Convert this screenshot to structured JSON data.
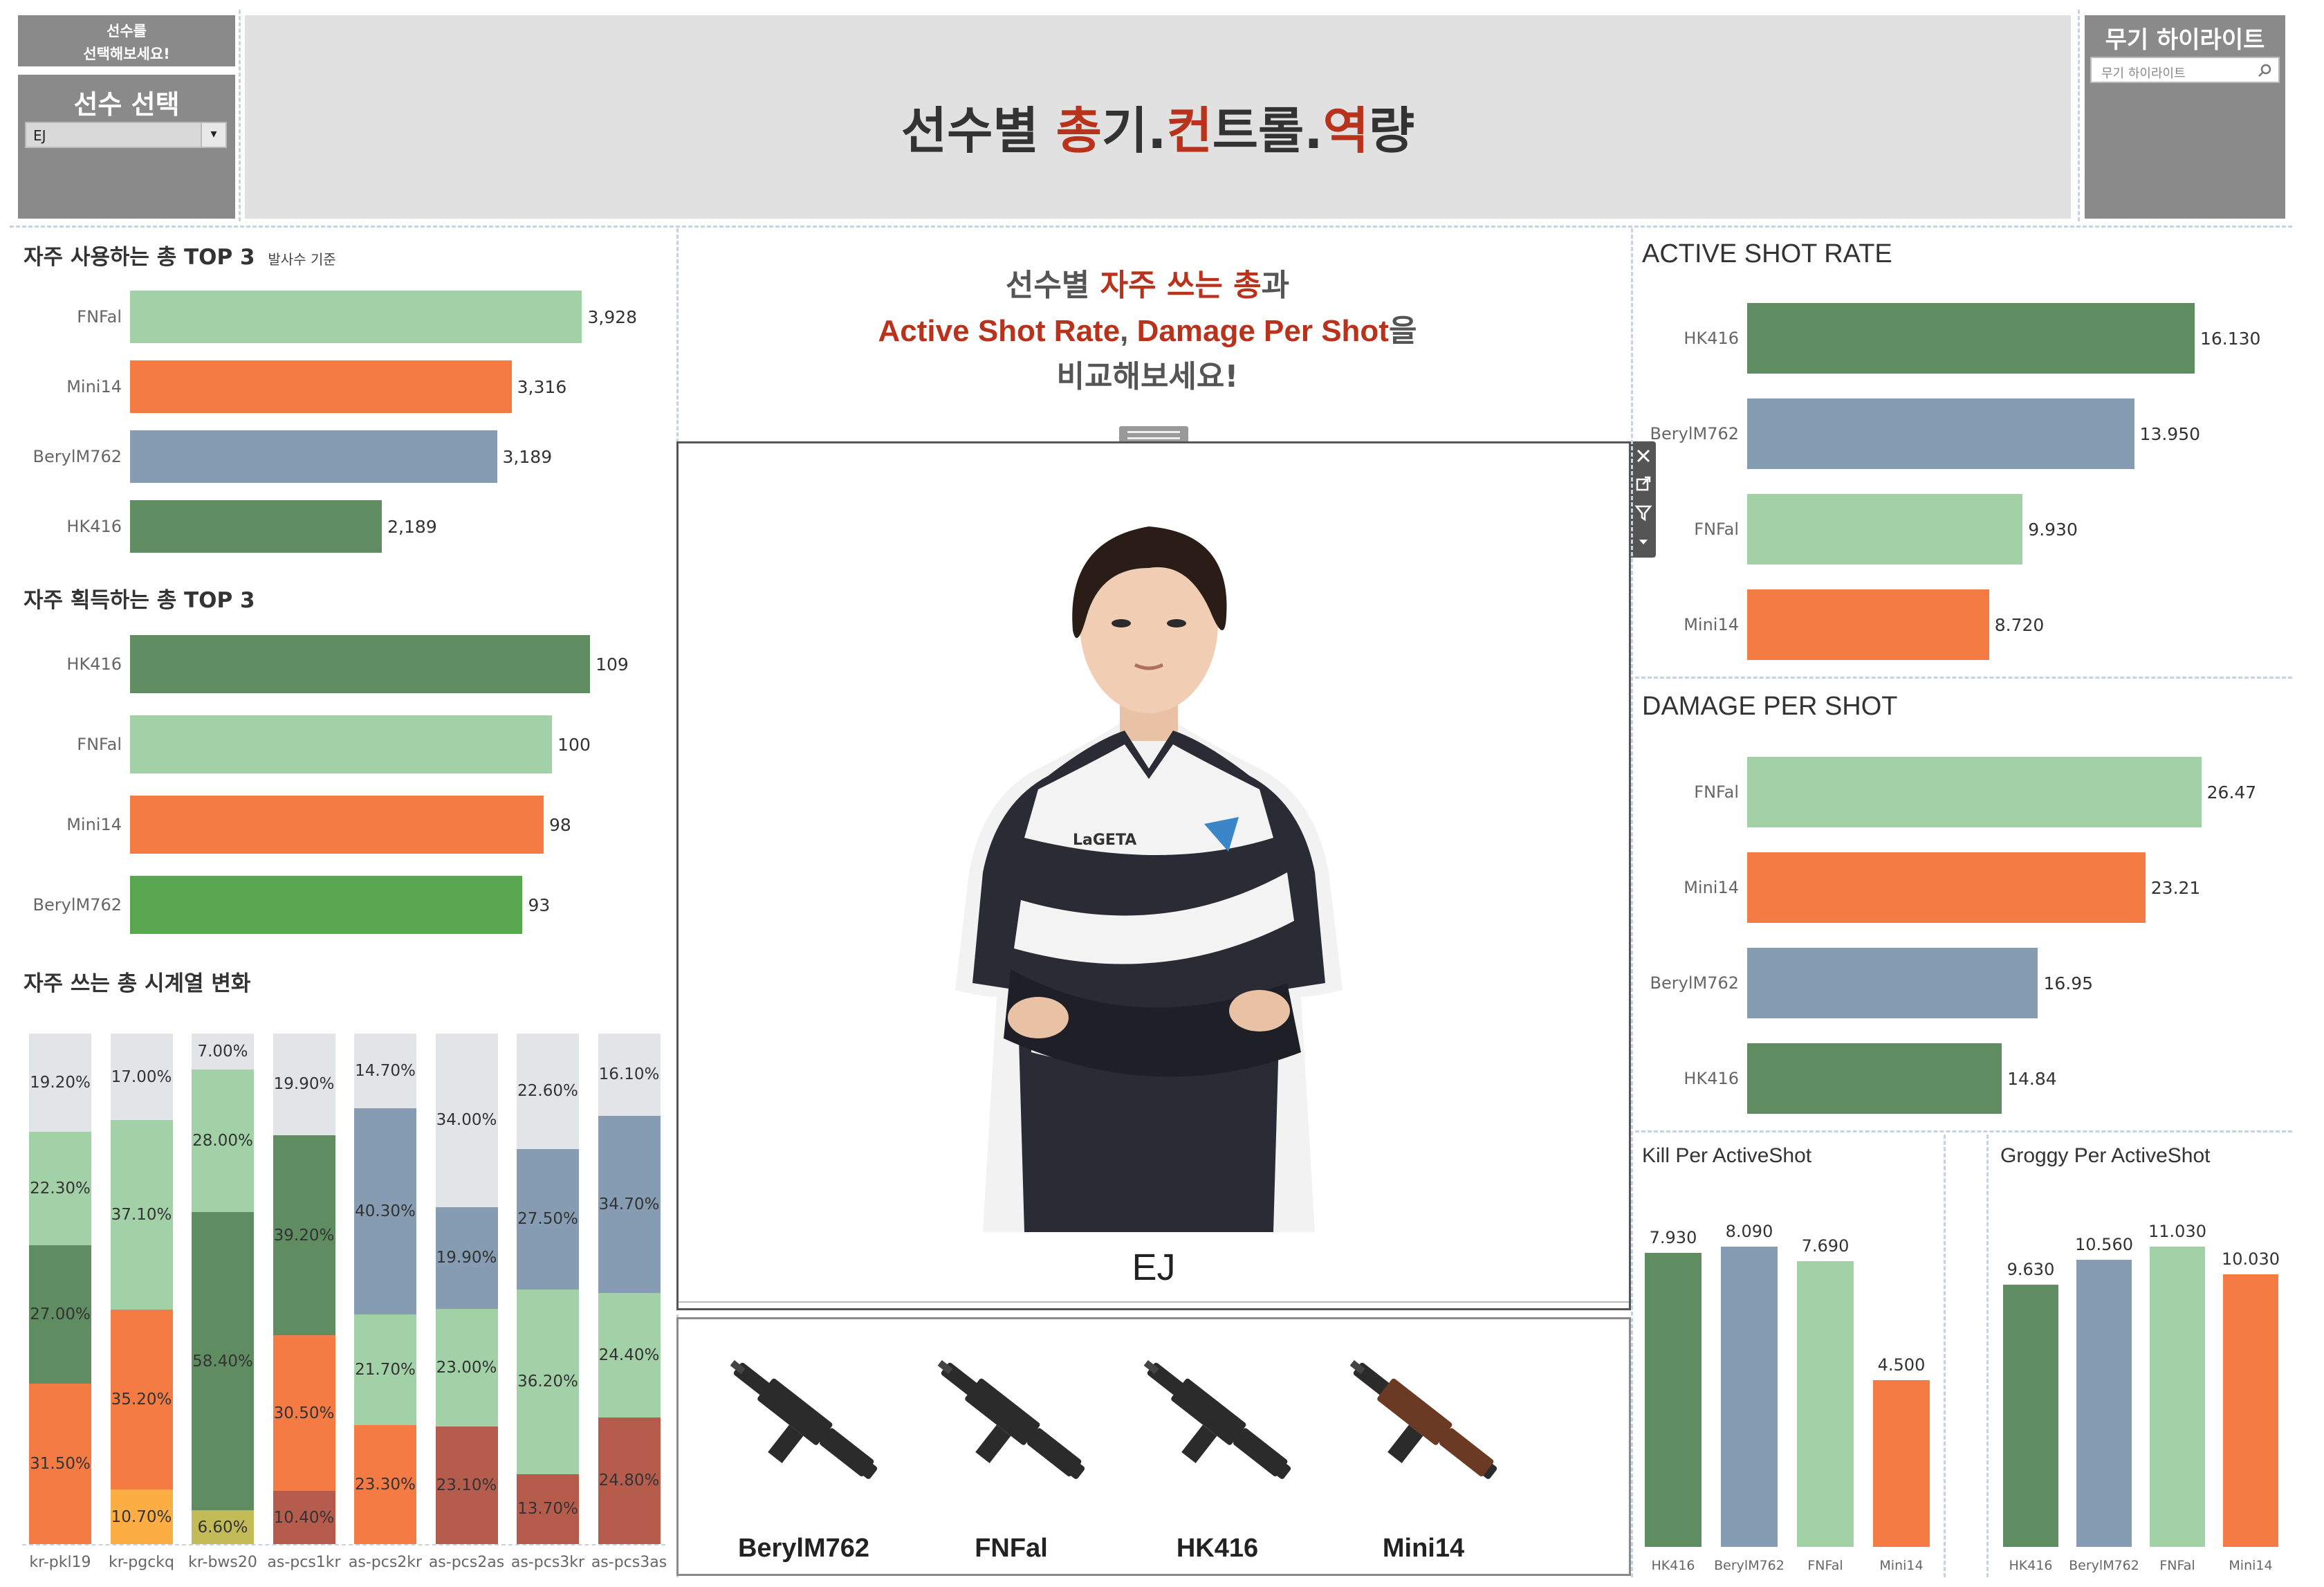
{
  "top_left": {
    "prompt_line1": "선수를",
    "prompt_line2": "선택해보세요!",
    "select_title": "선수 선택",
    "select_value": "EJ"
  },
  "header": {
    "title_parts": [
      {
        "text": "선수별 ",
        "accent": false
      },
      {
        "text": "총",
        "accent": true
      },
      {
        "text": "기.",
        "accent": false
      },
      {
        "text": "컨",
        "accent": true
      },
      {
        "text": "트롤.",
        "accent": false
      },
      {
        "text": "역",
        "accent": true
      },
      {
        "text": "량",
        "accent": false
      }
    ]
  },
  "top_right": {
    "title": "무기 하이라이트",
    "search_placeholder": "무기 하이라이트",
    "search_icon": "search-icon"
  },
  "colors": {
    "light_green": "#a3d1a7",
    "orange": "#f47b43",
    "blue_gray": "#859cb3",
    "dark_green": "#5f8c60",
    "bright_green": "#58a650",
    "light_gray": "#e2e4e7",
    "yellow_orange": "#fcae45",
    "brick": "#b65c4d",
    "olive": "#c3bb58",
    "accent_red": "#b8321c"
  },
  "center": {
    "intro_line1_a": "선수별 ",
    "intro_line1_b": "자주 쓰는 총",
    "intro_line1_c": "과",
    "intro_line2_a": "Active Shot Rate",
    "intro_line2_b": ", ",
    "intro_line2_c": "Damage Per Shot",
    "intro_line2_d": "을",
    "intro_line3": "비교해보세요!",
    "player_name": "EJ",
    "player_jersey_sponsor": "LaGETA",
    "viz_tools": [
      "close-icon",
      "external-link-icon",
      "filter-icon",
      "dropdown-icon"
    ]
  },
  "weapons": [
    {
      "name": "BerylM762"
    },
    {
      "name": "FNFal"
    },
    {
      "name": "HK416"
    },
    {
      "name": "Mini14"
    }
  ],
  "chart_data": [
    {
      "id": "top_used",
      "type": "bar",
      "title": "자주 사용하는 총 TOP 3",
      "subtitle": "발사수 기준",
      "categories": [
        "FNFal",
        "Mini14",
        "BerylM762",
        "HK416"
      ],
      "values": [
        3928,
        3316,
        3189,
        2189
      ],
      "value_labels": [
        "3,928",
        "3,316",
        "3,189",
        "2,189"
      ],
      "colors": [
        "#a3d1a7",
        "#f47b43",
        "#859cb3",
        "#5f8c60"
      ],
      "xlim": [
        0,
        4400
      ]
    },
    {
      "id": "top_acquired",
      "type": "bar",
      "title": "자주 획득하는 총 TOP 3",
      "categories": [
        "HK416",
        "FNFal",
        "Mini14",
        "BerylM762"
      ],
      "values": [
        109,
        100,
        98,
        93
      ],
      "value_labels": [
        "109",
        "100",
        "98",
        "93"
      ],
      "colors": [
        "#5f8c60",
        "#a3d1a7",
        "#f47b43",
        "#58a650"
      ],
      "xlim": [
        0,
        118
      ]
    },
    {
      "id": "timeseries",
      "type": "bar",
      "title": "자주 쓰는 총 시계열 변화",
      "categories": [
        "kr-pkl19",
        "kr-pgckq",
        "kr-bws20",
        "as-pcs1kr",
        "as-pcs2kr",
        "as-pcs2as",
        "as-pcs3kr",
        "as-pcs3as"
      ],
      "stacks": [
        [
          {
            "v": 19.2,
            "l": "19.20%",
            "c": "#e2e4e7"
          },
          {
            "v": 22.3,
            "l": "22.30%",
            "c": "#a3d1a7"
          },
          {
            "v": 27.0,
            "l": "27.00%",
            "c": "#5f8c60"
          },
          {
            "v": 31.5,
            "l": "31.50%",
            "c": "#f47b43"
          }
        ],
        [
          {
            "v": 17.0,
            "l": "17.00%",
            "c": "#e2e4e7"
          },
          {
            "v": 37.1,
            "l": "37.10%",
            "c": "#a3d1a7"
          },
          {
            "v": 35.2,
            "l": "35.20%",
            "c": "#f47b43"
          },
          {
            "v": 10.7,
            "l": "10.70%",
            "c": "#fcae45"
          }
        ],
        [
          {
            "v": 7.0,
            "l": "7.00%",
            "c": "#e2e4e7"
          },
          {
            "v": 28.0,
            "l": "28.00%",
            "c": "#a3d1a7"
          },
          {
            "v": 58.4,
            "l": "58.40%",
            "c": "#5f8c60"
          },
          {
            "v": 6.6,
            "l": "6.60%",
            "c": "#c3bb58"
          }
        ],
        [
          {
            "v": 19.9,
            "l": "19.90%",
            "c": "#e2e4e7"
          },
          {
            "v": 39.2,
            "l": "39.20%",
            "c": "#5f8c60"
          },
          {
            "v": 30.5,
            "l": "30.50%",
            "c": "#f47b43"
          },
          {
            "v": 10.4,
            "l": "10.40%",
            "c": "#b65c4d"
          }
        ],
        [
          {
            "v": 14.7,
            "l": "14.70%",
            "c": "#e2e4e7"
          },
          {
            "v": 40.3,
            "l": "40.30%",
            "c": "#859cb3"
          },
          {
            "v": 21.7,
            "l": "21.70%",
            "c": "#a3d1a7"
          },
          {
            "v": 23.3,
            "l": "23.30%",
            "c": "#f47b43"
          }
        ],
        [
          {
            "v": 34.0,
            "l": "34.00%",
            "c": "#e2e4e7"
          },
          {
            "v": 19.9,
            "l": "19.90%",
            "c": "#859cb3"
          },
          {
            "v": 23.0,
            "l": "23.00%",
            "c": "#a3d1a7"
          },
          {
            "v": 23.1,
            "l": "23.10%",
            "c": "#b65c4d"
          }
        ],
        [
          {
            "v": 22.6,
            "l": "22.60%",
            "c": "#e2e4e7"
          },
          {
            "v": 27.5,
            "l": "27.50%",
            "c": "#859cb3"
          },
          {
            "v": 36.2,
            "l": "36.20%",
            "c": "#a3d1a7"
          },
          {
            "v": 13.7,
            "l": "13.70%",
            "c": "#b65c4d"
          }
        ],
        [
          {
            "v": 16.1,
            "l": "16.10%",
            "c": "#e2e4e7"
          },
          {
            "v": 34.7,
            "l": "34.70%",
            "c": "#859cb3"
          },
          {
            "v": 24.4,
            "l": "24.40%",
            "c": "#a3d1a7"
          },
          {
            "v": 24.8,
            "l": "24.80%",
            "c": "#b65c4d"
          }
        ]
      ]
    },
    {
      "id": "active_shot_rate",
      "type": "bar",
      "title": "ACTIVE SHOT RATE",
      "categories": [
        "HK416",
        "BerylM762",
        "FNFal",
        "Mini14"
      ],
      "values": [
        16.13,
        13.95,
        9.93,
        8.72
      ],
      "value_labels": [
        "16.130",
        "13.950",
        "9.930",
        "8.720"
      ],
      "colors": [
        "#5f8c60",
        "#859cb3",
        "#a3d1a7",
        "#f47b43"
      ],
      "xlim": [
        0,
        18
      ]
    },
    {
      "id": "damage_per_shot",
      "type": "bar",
      "title": "DAMAGE PER SHOT",
      "categories": [
        "FNFal",
        "Mini14",
        "BerylM762",
        "HK416"
      ],
      "values": [
        26.47,
        23.21,
        16.95,
        14.84
      ],
      "value_labels": [
        "26.47",
        "23.21",
        "16.95",
        "14.84"
      ],
      "colors": [
        "#a3d1a7",
        "#f47b43",
        "#859cb3",
        "#5f8c60"
      ],
      "xlim": [
        0,
        28.5
      ]
    },
    {
      "id": "kill_per_activeshot",
      "type": "bar",
      "title": "Kill Per ActiveShot",
      "categories": [
        "HK416",
        "BerylM762",
        "FNFal",
        "Mini14"
      ],
      "values": [
        7.93,
        8.09,
        7.69,
        4.5
      ],
      "value_labels": [
        "7.930",
        "8.090",
        "7.690",
        "4.500"
      ],
      "colors": [
        "#5f8c60",
        "#859cb3",
        "#a3d1a7",
        "#f47b43"
      ],
      "ylim": [
        0,
        8.5
      ]
    },
    {
      "id": "groggy_per_activeshot",
      "type": "bar",
      "title": "Groggy Per ActiveShot",
      "categories": [
        "HK416",
        "BerylM762",
        "FNFal",
        "Mini14"
      ],
      "values": [
        9.63,
        10.56,
        11.03,
        10.03
      ],
      "value_labels": [
        "9.630",
        "10.560",
        "11.030",
        "10.030"
      ],
      "colors": [
        "#5f8c60",
        "#859cb3",
        "#a3d1a7",
        "#f47b43"
      ],
      "ylim": [
        0,
        11.6
      ]
    }
  ]
}
